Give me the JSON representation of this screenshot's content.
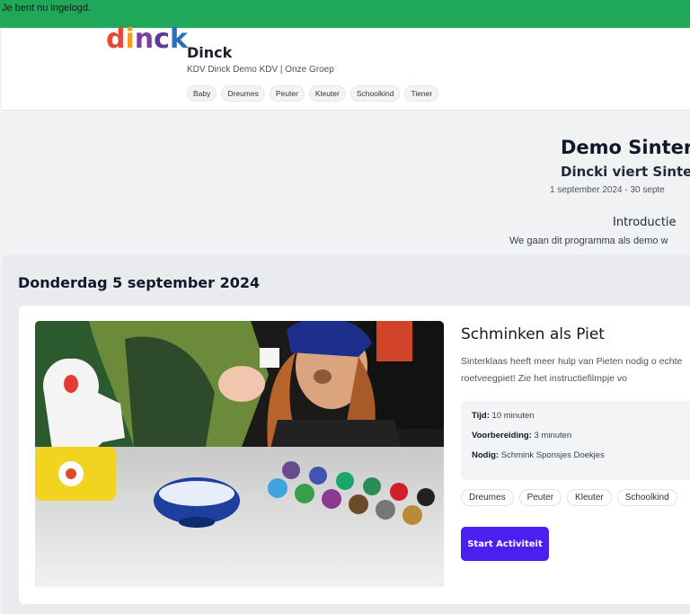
{
  "banner": {
    "text": "Je bent nu ingelogd."
  },
  "header": {
    "logo_letters": [
      "d",
      "i",
      "n",
      "c",
      "k"
    ],
    "brand_title": "Dinck",
    "brand_sub": "KDV Dinck Demo KDV | Onze Groep",
    "age_tags": [
      "Baby",
      "Dreumes",
      "Peuter",
      "Kleuter",
      "Schoolkind",
      "Tiener"
    ]
  },
  "program": {
    "title": "Demo Sinterl",
    "subtitle": "Dincki viert Sinte",
    "dates": "1 september 2024 - 30 septe",
    "intro_title": "Introductie",
    "intro_text": "We gaan dit programma als demo w"
  },
  "day": {
    "title": "Donderdag 5 september 2024"
  },
  "activity": {
    "title": "Schminken als Piet",
    "description": "Sinterklaas heeft meer hulp van Pieten nodig o echte roetveegpiet! Zie het instructiefilmpje vo",
    "details": {
      "time_label": "Tijd:",
      "time_value": "10 minuten",
      "prep_label": "Voorbereiding:",
      "prep_value": "3 minuten",
      "need_label": "Nodig:",
      "need_value": "Schmink Sponsjes Doekjes"
    },
    "tags": [
      "Dreumes",
      "Peuter",
      "Kleuter",
      "Schoolkind"
    ],
    "start_label": "Start Activiteit"
  },
  "colors": {
    "banner": "#1fa85a",
    "primary_button": "#4a1ff0"
  }
}
